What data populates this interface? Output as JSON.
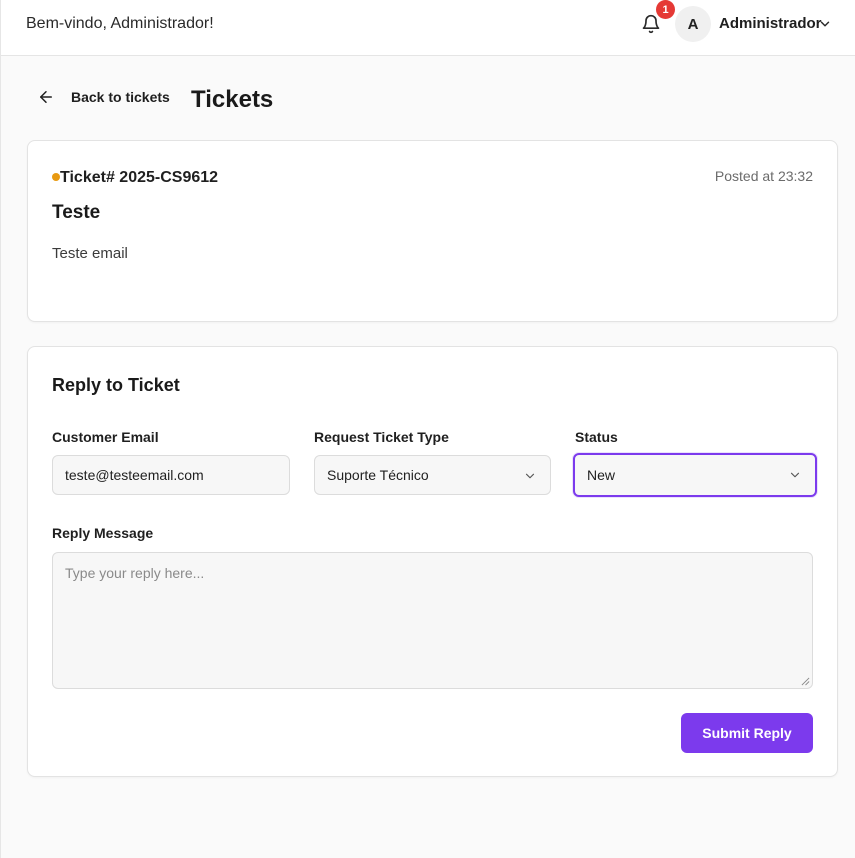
{
  "header": {
    "welcome": "Bem-vindo, Administrador!",
    "notification_count": "1",
    "avatar_initial": "A",
    "user_name": "Administrador"
  },
  "nav": {
    "back_label": "Back to tickets",
    "page_title": "Tickets"
  },
  "ticket": {
    "number": "Ticket# 2025-CS9612",
    "posted": "Posted at 23:32",
    "title": "Teste",
    "body": "Teste email",
    "status_dot_color": "#e89a12"
  },
  "reply": {
    "title": "Reply to Ticket",
    "customer_email_label": "Customer Email",
    "customer_email_value": "teste@testeemail.com",
    "request_type_label": "Request Ticket Type",
    "request_type_value": "Suporte Técnico",
    "status_label": "Status",
    "status_value": "New",
    "message_label": "Reply Message",
    "message_placeholder": "Type your reply here...",
    "submit_label": "Submit Reply"
  },
  "colors": {
    "accent": "#7c3aed",
    "badge": "#e53935"
  }
}
